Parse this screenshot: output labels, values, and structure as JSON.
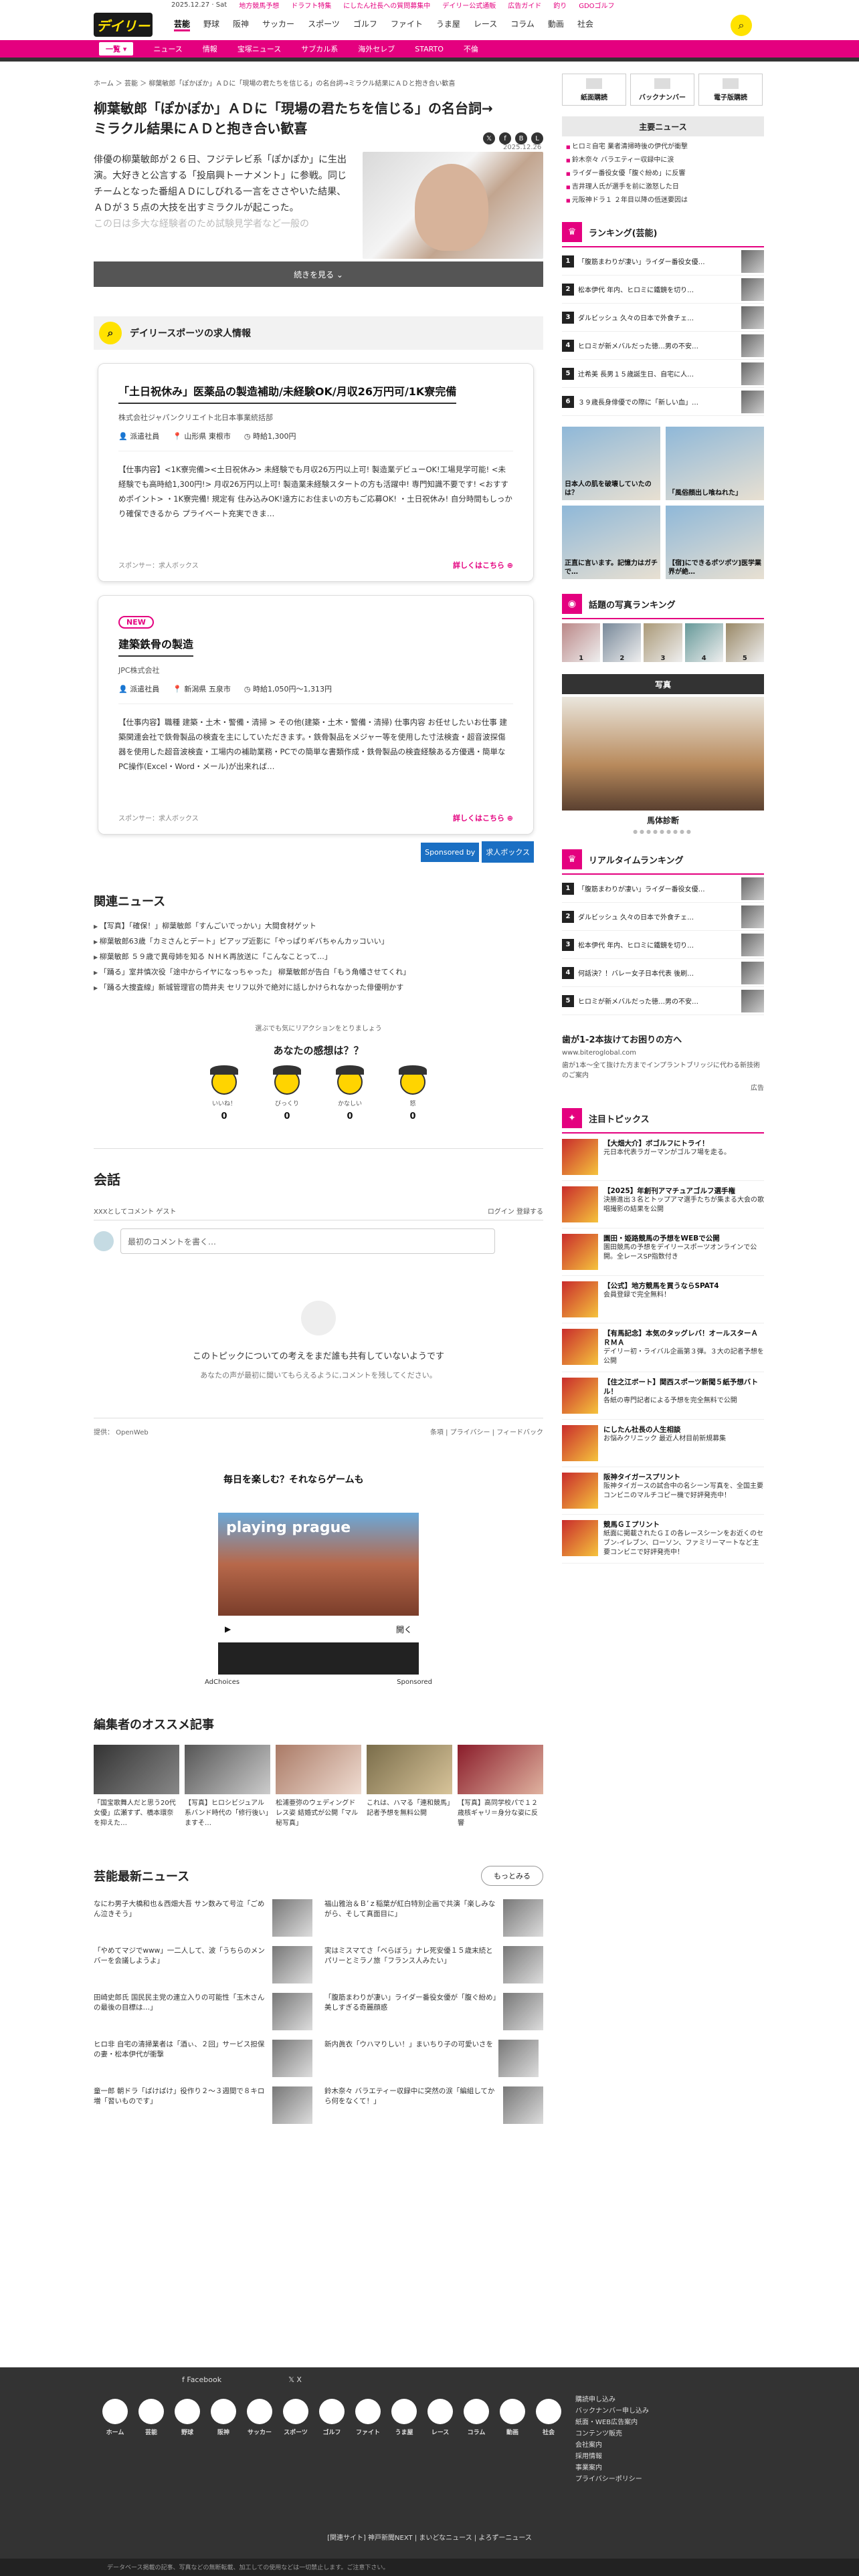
{
  "topline": {
    "date": "2025.12.27 · Sat",
    "links": [
      "地方競馬予想",
      "ドラフト特集",
      "にしたん社長への質問募集中",
      "デイリー公式通販",
      "広告ガイド",
      "釣り",
      "GDOゴルフ"
    ]
  },
  "header": {
    "logo": "デイリー",
    "nav": [
      "芸能",
      "野球",
      "阪神",
      "サッカー",
      "スポーツ",
      "ゴルフ",
      "ファイト",
      "うま屋",
      "レース",
      "コラム",
      "動画",
      "社会"
    ]
  },
  "pinkbar": {
    "all": "一覧 ▾",
    "items": [
      "ニュース",
      "情報",
      "宝塚ニュース",
      "サブカル系",
      "海外セレブ",
      "STARTO",
      "不倫"
    ]
  },
  "article": {
    "breadcrumb": "ホーム ＞ 芸能 ＞ 柳葉敏郎「ぽかぽか」ＡＤに「現場の君たちを信じる」の名台詞→ミラクル結果にＡＤと抱き合い歓喜",
    "title": "柳葉敏郎「ぽかぽか」ＡＤに「現場の君たちを信じる」の名台詞→ミラクル結果にＡＤと抱き合い歓喜",
    "date": "2025.12.26",
    "lead": "俳優の柳葉敏郎が２６日、フジテレビ系「ぽかぽか」に生出演。大好きと公言する「投扇興トーナメント」に参戦。同じチームとなった番組ＡＤにしびれる一言をささやいた結果、ＡＤが３５点の大技を出すミラクルが起こった。",
    "lead_fade": "この日は多大な経験者のため試験見学者など一般の",
    "more": "続きを見る ⌄"
  },
  "jobs": {
    "heading": "デイリースポーツの求人情報",
    "cards": [
      {
        "new": "",
        "title": "「土日祝休み」医薬品の製造補助/未経験OK/月収26万円可/1K寮完備",
        "company": "株式会社ジャパンクリエイト北日本事業統括部",
        "type": "派遣社員",
        "place": "山形県 東根市",
        "wage": "時給1,300円",
        "body": "【仕事内容】<1K寮完備><土日祝休み> 未経験でも月収26万円以上可! 製造業デビューOK!工場見学可能! <未経験でも高時給1,300円!> 月収26万円以上可! 製造業未経験スタートの方も活躍中! 専門知識不要です! <おすすめポイント> ・1K寮完備! 規定有 住み込みOK!遠方にお住まいの方もご応募OK! ・土日祝休み! 自分時間もしっかり確保できるから プライベート充実できま…",
        "sponsor": "スポンサー：求人ボックス",
        "detail": "詳しくはこちら"
      },
      {
        "new": "NEW",
        "title": "建築鉄骨の製造",
        "company": "JPC株式会社",
        "type": "派遣社員",
        "place": "新潟県 五泉市",
        "wage": "時給1,050円〜1,313円",
        "body": "【仕事内容】職種 建築・土木・警備・清掃 > その他(建築・土木・警備・清掃) 仕事内容 お任せしたいお仕事 建築関連会社で鉄骨製品の検査を主にしていただきます。・鉄骨製品をメジャー等を使用した寸法検査・超音波探傷器を使用した超音波検査・工場内の補助業務・PCでの簡単な書類作成・鉄骨製品の検査経験ある方優遇・簡単なPC操作(Excel・Word・メール)が出来れば…",
        "sponsor": "スポンサー：求人ボックス",
        "detail": "詳しくはこちら"
      }
    ],
    "sponsored_by": "Sponsored by",
    "badge": "求人ボックス"
  },
  "related": {
    "heading": "関連ニュース",
    "items": [
      "【写真】「確保！」柳葉敏郎「すんごいでっかい」大間食材ゲット",
      "柳葉敏郎63歳「カミさんとデート」ピアップ近影に「やっぱりギバちゃんカッコいい」",
      "柳葉敏郎 ５９歳で異母姉を知る ＮＨＫ再放送に「こんなことって…」",
      "「踊る」室井慎次役「途中からイヤになっちゃった」 柳葉敏郎が告白「もう角幡させてくれ」",
      "「踊る大捜査線」新城管理官の筒井夫 セリフ以外で絶対に話しかけられなかった俳優明かす"
    ]
  },
  "reactions": {
    "sub": "選ぶでも気にリアクションをとりましょう",
    "question": "あなたの感想は？？",
    "items": [
      {
        "label": "いいね！",
        "count": "0"
      },
      {
        "label": "びっくり",
        "count": "0"
      },
      {
        "label": "かなしい",
        "count": "0"
      },
      {
        "label": "怒",
        "count": "0"
      }
    ]
  },
  "conversation": {
    "title": "会話",
    "guest": "XXXとしてコメント ゲスト",
    "login": "ログイン 登録する",
    "placeholder": "最初のコメントを書く…",
    "empty_title": "このトピックについての考えをまだ誰も共有していないようです",
    "empty_sub": "あなたの声が最初に聞いてもらえるように,コメントを残してください。",
    "provided": "提供： OpenWeb",
    "footer_links": "条項 | プライバシー | フィードバック"
  },
  "ad": {
    "headline": "毎日を楽しむ？それならゲームも",
    "brand": "playing prague",
    "open": "開く",
    "adchoices": "AdChoices",
    "sponsored": "Sponsored"
  },
  "editors": {
    "heading": "編集者のオススメ記事",
    "items": [
      "「国宝歌舞人だと思う20代女優」広瀬すず、橋本環奈を抑えた…",
      "【写真】ヒロシビジュアル系バンド時代の「修行後い」ますそ…",
      "松浦亜弥のウェディングドレス姿 結婚式が公開「マル秘写真」",
      "これは、ハマる「連和競馬」記者予想を無料公開",
      "【写真】高同学校パで１２歳核ギャリ＝身分な姿に反響"
    ]
  },
  "latest": {
    "heading": "芸能最新ニュース",
    "more": "もっとみる",
    "items": [
      "なにわ男子大橋和也＆西畑大吾 サン数みて号泣「ごめん泣きそう」",
      "福山雅治＆Ｂ’ｚ稲葉が紅白特別企画で共演「楽しみながら、そして真面目に」",
      "「やめてマジでwww」一二人して、波「うちらのメンバーを会議しようよ」",
      "実はミスマてさ「ベらぼう」ナレ死安優１５歳末続とパリーとミラノ旅「フランス人みたい」",
      "田崎史郎氏 国民民主党の連立入りの可能性「玉木さんの最後の目標は…」",
      "「腹筋まわりが凄い」ライダー番役女優が「腹ぐ紛め」美しすぎる奇麗顔惑",
      "ヒロ非 自宅の清掃業者は「酒ぃ、２回」サービス担保の妻・松本伊代が衝撃",
      "新内眞衣「ウハマりしい！」まいちり子の可愛いさを",
      "童一郎 朝ドラ「ばけばけ」役作り２〜３週間で８キロ増「習いものです」",
      "鈴木奈々 バラエティー収録中に突然の涙「編組してから何をなくて！」"
    ]
  },
  "side": {
    "buttons": [
      "紙面購読",
      "バックナンバー",
      "電子版購読"
    ],
    "main_news_heading": "主要ニュース",
    "main_news": [
      "ヒロミ自宅 業者清掃時後の伊代が衝撃",
      "鈴木奈々 バラエティー収録中に涙",
      "ライダー番役女優「腹ぐ紛め」に反響",
      "吉井理人氏が選手を前に激怒した日",
      "元阪神ドラ１ ２年目以降の低迷要因は"
    ],
    "ranking_heading": "ランキング(芸能)",
    "ranking": [
      "「腹筋まわりが凄い」ライダー番役女優…",
      "松本伊代 年内、ヒロミに鐵鏡を切り…",
      "ダルビッシュ 久々の日本で外食チェ…",
      "ヒロミが新メバルだった徳…男の不安…",
      "辻希美 長男１５歳誕生日、自宅に人…",
      "３９歳長身俳優での際に「新しい血」…"
    ],
    "ads": [
      "日本人の肌を破壊していたのは？",
      "「風俗顔出し喰ねれた」",
      "正直に言います。記憶力はガチで…",
      "【宿]にできるポツポツ]医学業界が絶…"
    ],
    "photo_ranking_heading": "話題の写真ランキング",
    "photo_ranks": [
      "1",
      "2",
      "3",
      "4",
      "5"
    ],
    "photo_heading": "写真",
    "photo_caption": "馬体診断",
    "realtime_heading": "リアルタイムランキング",
    "realtime": [
      "「腹筋まわりが凄い」ライダー番役女優…",
      "ダルビッシュ 久々の日本で外食チェ…",
      "松本伊代 年内、ヒロミに鐵鏡を切り…",
      "何話決？！バレー女子日本代表 後刷…",
      "ヒロミが新メバルだった徳…男の不安…"
    ],
    "textad_title": "歯が1-2本抜けてお困りの方へ",
    "textad_url": "www.biteroglobal.com",
    "textad_body": "歯が1本〜全て抜けた方までインプラントブリッジに代わる新技術のご案内",
    "adlabel": "広告",
    "topics_heading": "注目トピックス",
    "topics": [
      {
        "title": "【大畑大介】ボゴルフにトライ！",
        "desc": "元日本代表ラガーマンがゴルフ場を走る。"
      },
      {
        "title": "【2025】年創刊アマチュアゴルフ選手権",
        "desc": "決勝進出３名とトップアマ選手たちが集まる大会の歌唱撮影の結果を公開"
      },
      {
        "title": "園田・姫路競馬の予想をWEBで公開",
        "desc": "園田競馬の予想をデイリースポーツオンラインで公開。全レースSP指数付き"
      },
      {
        "title": "【公式】地方競馬を買うならSPAT4",
        "desc": "会員登録で完全無料！"
      },
      {
        "title": "【有馬記念】本気のタッグレバ！オールスターＡＲＭＡ",
        "desc": "デイリー初・ライバル企画第３弾。３大の記者予想を公開"
      },
      {
        "title": "【住之江ボート】関西スポーツ新聞５紙予想バトル！",
        "desc": "各紙の専門記者による予想を完全無料で公開"
      },
      {
        "title": "にしたん社長の人生相談",
        "desc": "お悩みクリニック 最近人材目前新規募集"
      },
      {
        "title": "阪神タイガースプリント",
        "desc": "阪神タイガースの試合中の名シーン写真を、全国主要コンビニのマルチコピー機で好評発売中！"
      },
      {
        "title": "競馬ＧＩプリント",
        "desc": "紙面に掲載されたＧＩの各レースシーンをお近くのセブン-イレブン、ローソン、ファミリーマートなど主要コンビニで好評発売中！"
      }
    ]
  },
  "footer": {
    "facebook": "Facebook",
    "x": "X",
    "icons": [
      "ホーム",
      "芸能",
      "野球",
      "阪神",
      "サッカー",
      "スポーツ",
      "ゴルフ",
      "ファイト",
      "うま屋",
      "レース",
      "コラム",
      "動画",
      "社会"
    ],
    "links": [
      "購読申し込み",
      "バックナンバー申し込み",
      "紙面・WEB広告案内",
      "コンテンツ販売",
      "会社案内",
      "採用情報",
      "事業案内",
      "プライバシーポリシー"
    ],
    "bottom": "[関連サイト] 神戸新聞NEXT | まいどなニュース | よろずーニュース",
    "copyright": "データベース掲載の記事、写真などの無断転載、加工しての使用などは一切禁止します。ご注意下さい。"
  }
}
